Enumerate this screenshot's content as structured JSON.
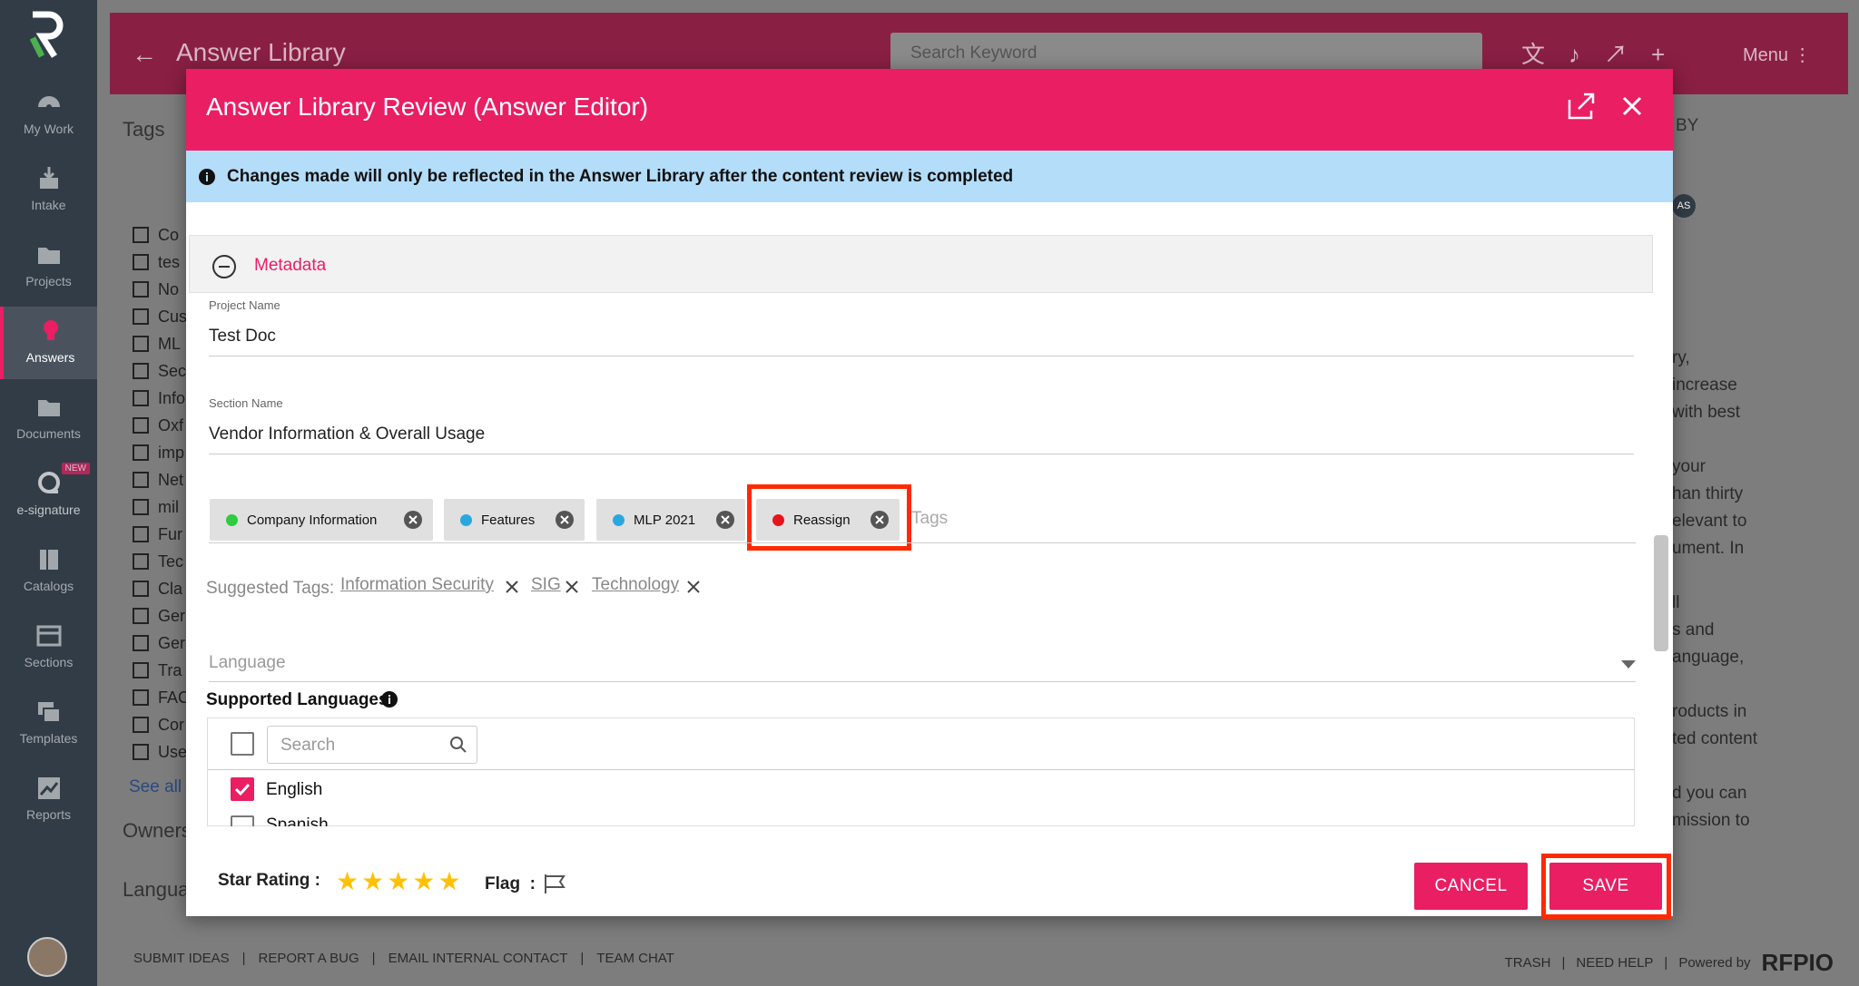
{
  "sidebar": {
    "items": [
      {
        "label": "My Work"
      },
      {
        "label": "Intake"
      },
      {
        "label": "Projects"
      },
      {
        "label": "Answers"
      },
      {
        "label": "Documents"
      },
      {
        "label": "e-signature",
        "badge": "NEW"
      },
      {
        "label": "Catalogs"
      },
      {
        "label": "Sections"
      },
      {
        "label": "Templates"
      },
      {
        "label": "Reports"
      }
    ]
  },
  "background": {
    "title": "Answer Library",
    "search_placeholder": "Search Keyword",
    "menu_label": "Menu",
    "tags_heading": "Tags",
    "tag_fragments": [
      "Co",
      "tes",
      "No",
      "Cus",
      "ML",
      "Sec",
      "Info",
      "Oxf",
      "imp",
      "Net",
      "mil",
      "Fur",
      "Tec",
      "Cla",
      "Ger",
      "Ger",
      "Tra",
      "FAC",
      "Cor",
      "Use"
    ],
    "see_all": "See all T",
    "owners": "Owners",
    "language": "Langua",
    "by_label": "BY",
    "avatar_initials": "AS",
    "right_text": [
      "ry,",
      "increase",
      "with best",
      "",
      "your",
      "han thirty",
      "elevant to",
      "ument. In",
      "",
      "ll",
      "s and",
      "anguage,",
      "",
      "roducts in",
      "ted content",
      "",
      "d you can",
      "mission to"
    ]
  },
  "bottom_bar": {
    "left": [
      "SUBMIT IDEAS",
      "REPORT A BUG",
      "EMAIL INTERNAL CONTACT",
      "TEAM CHAT"
    ],
    "right": [
      "TRASH",
      "NEED HELP"
    ],
    "powered_by": "Powered by",
    "brand": "RFPIO"
  },
  "modal": {
    "title": "Answer Library Review (Answer Editor)",
    "info_banner": "Changes made will only be reflected in the Answer Library after the content review is completed",
    "metadata_heading": "Metadata",
    "project_name_label": "Project Name",
    "project_name_value": "Test Doc",
    "section_name_label": "Section Name",
    "section_name_value": "Vendor Information & Overall Usage",
    "tags": [
      {
        "label": "Company Information",
        "color": "#2ecc40"
      },
      {
        "label": "Features",
        "color": "#29a8e0"
      },
      {
        "label": "MLP 2021",
        "color": "#29a8e0"
      },
      {
        "label": "Reassign",
        "color": "#e8141b"
      }
    ],
    "tags_placeholder": "Tags",
    "suggested_label": "Suggested Tags:",
    "suggested_tags": [
      "Information Security",
      "SIG",
      "Technology"
    ],
    "language_placeholder": "Language",
    "supported_languages_label": "Supported Languages",
    "language_search_placeholder": "Search",
    "languages": [
      {
        "name": "English",
        "checked": true
      },
      {
        "name": "Spanish",
        "checked": false
      }
    ],
    "star_rating_label": "Star Rating :",
    "star_rating": 5,
    "flag_label": "Flag",
    "flag_separator": ":",
    "cancel_label": "CANCEL",
    "save_label": "SAVE",
    "highlight_color": "#ff2a00"
  }
}
